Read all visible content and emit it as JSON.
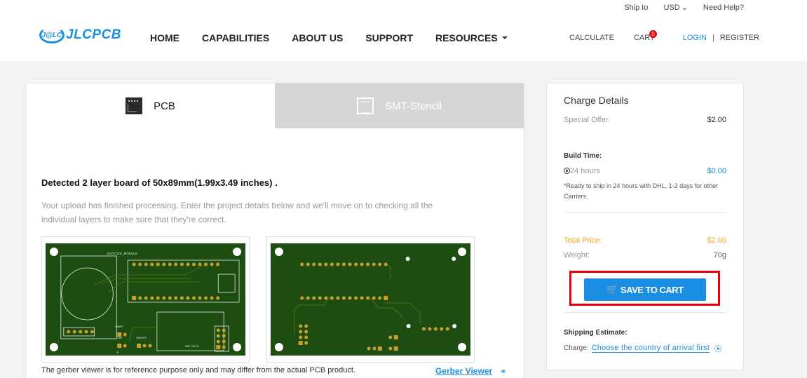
{
  "header": {
    "topbar": {
      "ship_to": "Ship to",
      "currency": "USD",
      "help": "Need Help?"
    },
    "logo": {
      "mark": "J@LC",
      "text": "JLCPCB"
    },
    "nav": [
      {
        "label": "HOME"
      },
      {
        "label": "CAPABILITIES"
      },
      {
        "label": "ABOUT US"
      },
      {
        "label": "SUPPORT"
      },
      {
        "label": "RESOURCES",
        "has_dropdown": true
      }
    ],
    "calculate": "CALCULATE",
    "cart": {
      "label": "CART",
      "count": "0"
    },
    "login": "LOGIN",
    "separator": "|",
    "register": "REGISTER"
  },
  "tabs": [
    {
      "label": "PCB",
      "icon": "pcb-icon",
      "active": true
    },
    {
      "label": "SMT-Stencil",
      "icon": "stencil-icon",
      "active": false
    }
  ],
  "main": {
    "detected": "Detected 2 layer board of 50x89mm(1.99x3.49 inches) .",
    "description": "Your upload has finished processing. Enter the project details below and we'll move on to checking all the individual layers to make sure that they're correct.",
    "pcb_top_labels": {
      "module": "JOYSTICK_MODULE",
      "obrf": "OBRF",
      "vin": "VIN",
      "on_off": "ON/OFF",
      "part": "NRF 24L01",
      "plus": "+",
      "minus": "-"
    },
    "disclaimer": "The gerber viewer is for reference purpose only and may differ from the actual PCB product.",
    "gerber_link": "Gerber Viewer"
  },
  "charge": {
    "title": "Charge Details",
    "special_offer": {
      "label": "Special Offer:",
      "value": "$2.00"
    },
    "build_time": {
      "title": "Build Time:",
      "option": "24 hours",
      "price": "$0.00",
      "note": "*Ready to ship in 24 hours with DHL, 1-2 days for other Carriers."
    },
    "total": {
      "label": "Total Price:",
      "value": "$2.00"
    },
    "weight": {
      "label": "Weight:",
      "value": "70g"
    },
    "save_button": "SAVE TO CART",
    "shipping": {
      "title": "Shipping Estimate:",
      "charge_label": "Charge:",
      "link": "Choose the country of arrival first"
    }
  },
  "colors": {
    "accent": "#1a8fe3",
    "total": "#f5a623",
    "highlight": "#e8000b",
    "pcb_green": "#1e4d12",
    "pad_gold": "#c8a030"
  }
}
